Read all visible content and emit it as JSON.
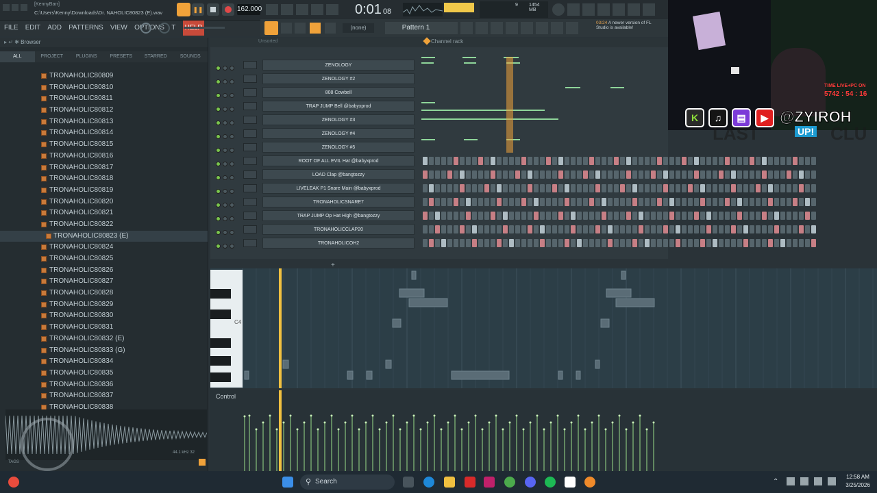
{
  "title_bar": {
    "user": "[KennyBarr]",
    "path": "C:\\Users\\Kenny\\Downloads\\Dr. NAHOLIC80823 (E).wav",
    "tempo": "162.000",
    "time": "0:01",
    "time_frac": "08",
    "memory": "1454 MB",
    "cpu": "9"
  },
  "menu": [
    "FILE",
    "EDIT",
    "ADD",
    "PATTERNS",
    "VIEW",
    "OPTIONS",
    "T",
    "HELP"
  ],
  "toolbar": {
    "preset_none": "(none)",
    "pattern": "Pattern 1",
    "notice_date": "03/24",
    "notice_text": "A newer version of FL Studio is available!"
  },
  "browser": {
    "title": "Browser",
    "tabs": [
      "ALL",
      "PROJECT",
      "PLUGINS",
      "PRESETS",
      "STARRED",
      "SOUNDS"
    ],
    "files": [
      "TRONAHOLIC80809",
      "TRONAHOLIC80810",
      "TRONAHOLIC80811",
      "TRONAHOLIC80812",
      "TRONAHOLIC80813",
      "TRONAHOLIC80814",
      "TRONAHOLIC80815",
      "TRONAHOLIC80816",
      "TRONAHOLIC80817",
      "TRONAHOLIC80818",
      "TRONAHOLIC80819",
      "TRONAHOLIC80820",
      "TRONAHOLIC80821",
      "TRONAHOLIC80822",
      "TRONAHOLIC80823 (E)",
      "TRONAHOLIC80824",
      "TRONAHOLIC80825",
      "TRONAHOLIC80826",
      "TRONAHOLIC80827",
      "TRONAHOLIC80828",
      "TRONAHOLIC80829",
      "TRONAHOLIC80830",
      "TRONAHOLIC80831",
      "TRONAHOLIC80832 (E)",
      "TRONAHOLIC80833 (G)",
      "TRONAHOLIC80834",
      "TRONAHOLIC80835",
      "TRONAHOLIC80836",
      "TRONAHOLIC80837",
      "TRONAHOLIC80838"
    ],
    "selected_index": 14,
    "wave_info": "44.1 kHz 32",
    "tags_label": "TAGS"
  },
  "channel_rack": {
    "filter": "Unsorted",
    "title": "Channel rack",
    "channels": [
      {
        "name": "ZENOLOGY",
        "steps": false
      },
      {
        "name": "ZENOLOGY #2",
        "steps": false
      },
      {
        "name": "808 Cowbell",
        "steps": false
      },
      {
        "name": "TRAP JUMP Bell @babyxprod",
        "steps": false
      },
      {
        "name": "ZENOLOGY #3",
        "steps": false
      },
      {
        "name": "ZENOLOGY #4",
        "steps": false
      },
      {
        "name": "ZENOLOGY #5",
        "steps": false
      },
      {
        "name": "ROOT OF ALL EVIL Hat @babyxprod",
        "steps": true
      },
      {
        "name": "LOAD Clap @bangtozzy",
        "steps": true
      },
      {
        "name": "LIVELEAK P1 Snare Main @babyxprod",
        "steps": true
      },
      {
        "name": "TRONAHOLICSNARE7",
        "steps": true
      },
      {
        "name": "TRAP JUMP Op Hat High @bangtozzy",
        "steps": true
      },
      {
        "name": "TRONAHOLICCLAP20",
        "steps": true
      },
      {
        "name": "TRONAHOLICOH2",
        "steps": true
      }
    ]
  },
  "piano_roll": {
    "note_label": "C4"
  },
  "control_panel": {
    "label": "Control"
  },
  "webcam": {
    "overlay_label": "TIME LIVE+PC ON",
    "overlay_timer": "5742 : 54 : 16",
    "handle": "@ZYIROH",
    "bg_text": "LAST",
    "bg_text2": "UP!",
    "bg_text3": "CLU"
  },
  "taskbar": {
    "search": "Search",
    "time": "12:58 AM",
    "date": "3/25/2026"
  },
  "colors": {
    "accent": "#f0a23a",
    "active_green": "#7ac64e",
    "step_red": "#c77f85"
  }
}
